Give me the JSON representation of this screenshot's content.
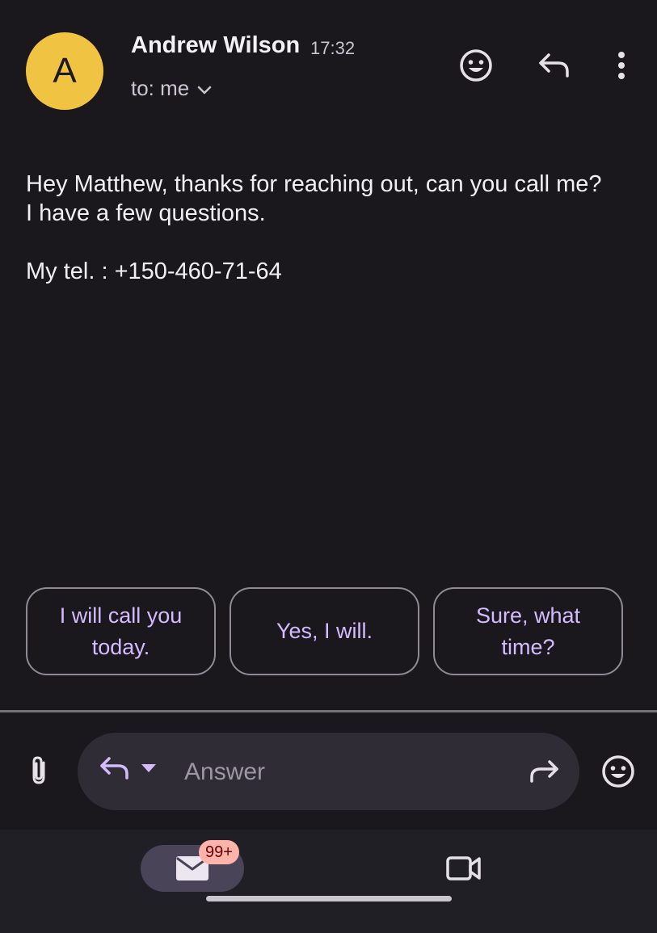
{
  "email": {
    "avatar_letter": "A",
    "sender": "Andrew Wilson",
    "time": "17:32",
    "recipients": "to: me",
    "body": [
      "Hey Matthew, thanks for reaching out, can you call me?",
      "I have a few questions.",
      "",
      "My tel. : +150-460-71-64"
    ]
  },
  "header_actions": {
    "emoji_icon": "emoji-reaction-icon",
    "reply_icon": "reply-icon",
    "more_icon": "more-vert-icon"
  },
  "smart_replies": [
    "I will call you today.",
    "Yes, I will.",
    "Sure, what time?"
  ],
  "compose": {
    "placeholder": "Answer",
    "attach_icon": "paperclip-icon",
    "reply_mode_icon": "reply-icon",
    "forward_icon": "forward-icon",
    "emoji_icon": "emoji-icon"
  },
  "bottom_nav": {
    "mail_badge": "99+",
    "mail_icon": "mail-icon",
    "meet_icon": "video-camera-icon"
  },
  "colors": {
    "background": "#1a181d",
    "avatar": "#f0c342",
    "accent": "#d4bbff",
    "badge": "#ffb4ab"
  }
}
